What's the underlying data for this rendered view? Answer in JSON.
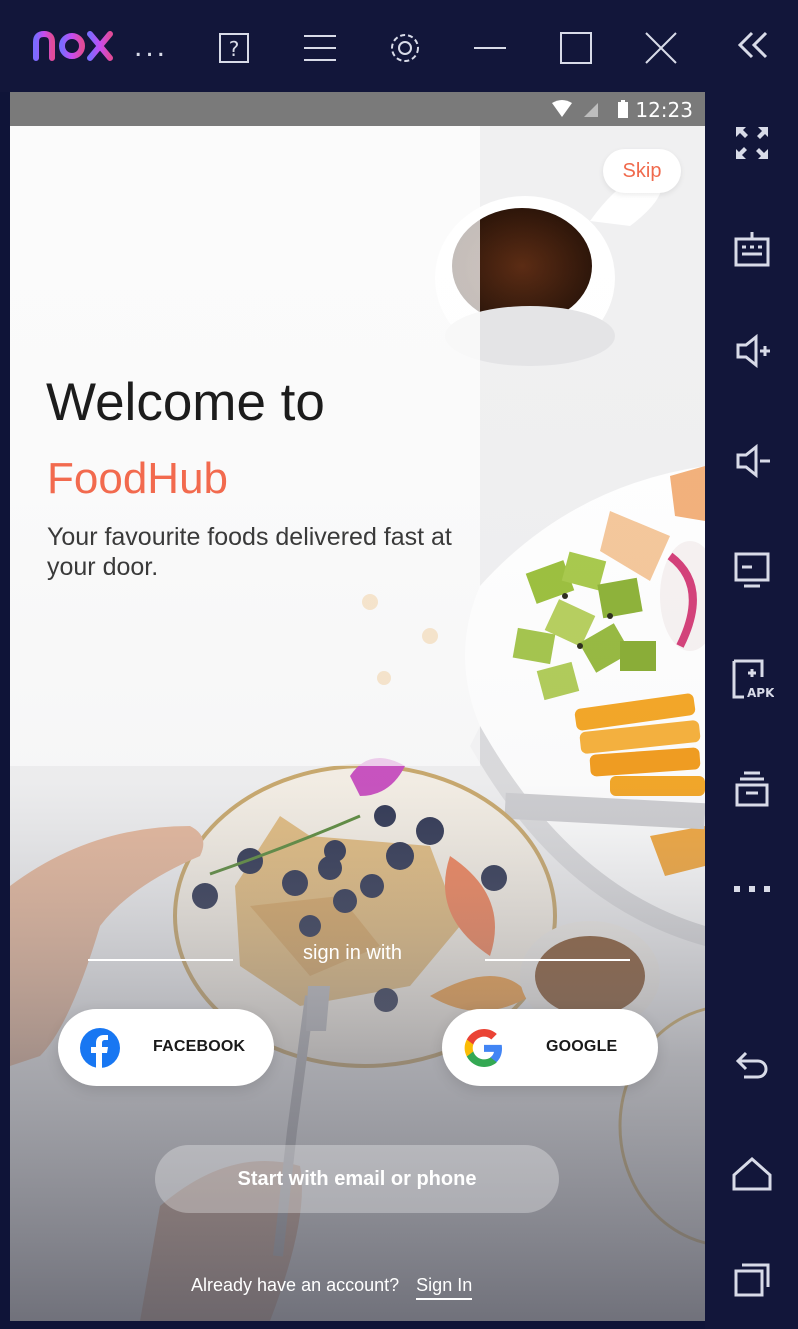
{
  "emulator": {
    "logo_text": "nox",
    "menu_dots": "...",
    "toolbar_icons": [
      "help-icon",
      "menu-icon",
      "settings-icon",
      "minimize-icon",
      "maximize-icon",
      "close-icon",
      "collapse-icon"
    ],
    "sidebar_icons": [
      "fullscreen-icon",
      "keyboard-icon",
      "volume-up-icon",
      "volume-down-icon",
      "screen-icon",
      "install-apk-icon",
      "multi-instance-icon",
      "more-icon",
      "back-icon",
      "home-icon",
      "recent-apps-icon"
    ]
  },
  "status_bar": {
    "time": "12:23"
  },
  "onboarding": {
    "skip_label": "Skip",
    "welcome_title": "Welcome to",
    "brand_name": "FoodHub",
    "tagline": "Your favourite foods delivered fast at your door.",
    "sign_in_with": "sign in with",
    "facebook_label": "FACEBOOK",
    "google_label": "GOOGLE",
    "email_button": "Start with email or phone",
    "account_prompt": "Already have an account?",
    "sign_in_link": "Sign In"
  },
  "colors": {
    "brand": "#F26A4E",
    "emulator_chrome": "#12163A",
    "facebook": "#1877F2"
  }
}
